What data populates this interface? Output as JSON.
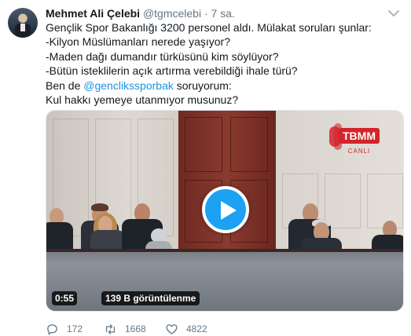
{
  "tweet": {
    "author_name": "Mehmet Ali Çelebi",
    "handle": "@tgmcelebi",
    "separator": "·",
    "time": "7 sa.",
    "lines": [
      "Gençlik Spor Bakanlığı 3200 personel aldı. Mülakat soruları şunlar:",
      "-Kilyon Müslümanları nerede yaşıyor?",
      "-Maden dağı dumandır türküsünü kim söylüyor?",
      "-Bütün isteklilerin açık artırma verebildiği ihale türü?"
    ],
    "mention_prefix": "Ben de ",
    "mention": "@genclikssporbak",
    "mention_suffix": " soruyorum:",
    "last_line": "Kul hakkı yemeye utanmıyor musunuz?"
  },
  "media": {
    "broadcast_logo_text": "TBMM",
    "broadcast_sub_text": "CANLI",
    "duration": "0:55",
    "views": "139 B görüntülenme"
  },
  "actions": {
    "reply_count": "172",
    "retweet_count": "1668",
    "like_count": "4822"
  },
  "colors": {
    "link": "#1b95e0",
    "play_button": "#1da1f2",
    "secondary_text": "#657786",
    "tbmm_red": "#d3242a"
  },
  "icons": [
    "reply-icon",
    "retweet-icon",
    "like-icon",
    "play-icon",
    "chevron-down-icon"
  ]
}
